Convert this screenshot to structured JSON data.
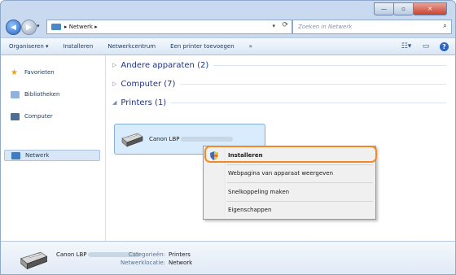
{
  "window": {
    "minimize_glyph": "—",
    "maximize_glyph": "▫",
    "close_glyph": "✕"
  },
  "nav": {
    "back_glyph": "◀",
    "forward_glyph": "▶"
  },
  "address": {
    "breadcrumb": "▸ Netwerk ▸",
    "refresh_glyph": "⟳"
  },
  "search": {
    "placeholder": "Zoeken in Netwerk"
  },
  "toolbar": {
    "organize": "Organiseren ▾",
    "install": "Installeren",
    "network_center": "Netwerkcentrum",
    "add_printer": "Een printer toevoegen",
    "more": "»"
  },
  "sidebar": {
    "items": [
      {
        "label": "Favorieten"
      },
      {
        "label": "Bibliotheken"
      },
      {
        "label": "Computer"
      },
      {
        "label": "Netwerk"
      }
    ]
  },
  "groups": {
    "other": "Andere apparaten (2)",
    "computer": "Computer (7)",
    "printers": "Printers (1)"
  },
  "printer": {
    "name": "Canon LBP"
  },
  "context_menu": {
    "items": [
      {
        "label": "Installeren"
      },
      {
        "label": "Webpagina van apparaat weergeven"
      },
      {
        "label": "Snelkoppeling maken"
      },
      {
        "label": "Eigenschappen"
      }
    ]
  },
  "details": {
    "name": "Canon LBP",
    "category_label": "Categorieën:",
    "category_value": "Printers",
    "location_label": "Netwerklocatie:",
    "location_value": "Network"
  },
  "colors": {
    "accent": "#f08a24",
    "selection": "#d9ecfd",
    "link": "#1e3287"
  }
}
